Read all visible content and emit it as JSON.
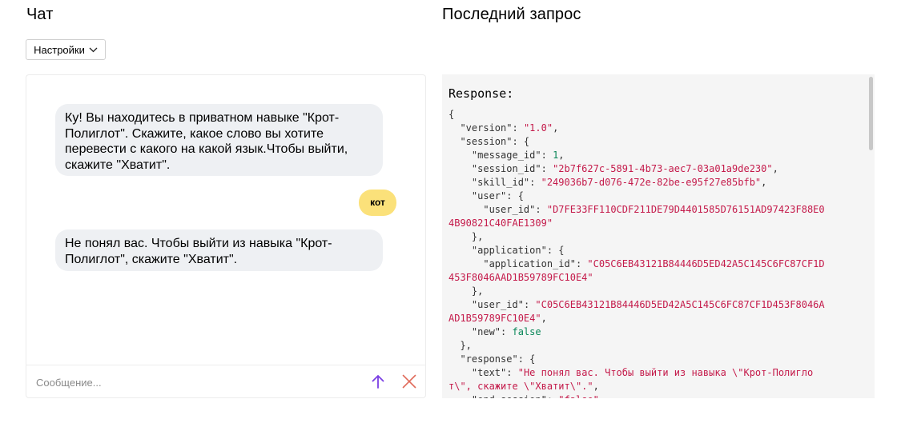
{
  "chat": {
    "title": "Чат",
    "settings_label": "Настройки",
    "messages": [
      {
        "role": "bot",
        "text": "Ку! Вы находитесь в приватном навыке \"Крот-Полиглот\". Скажите, какое слово вы хотите перевести с какого на какой язык.Чтобы выйти, скажите \"Хватит\"."
      },
      {
        "role": "user",
        "text": "кот"
      },
      {
        "role": "bot",
        "text": "Не понял вас. Чтобы выйти из навыка \"Крот-Полиглот\", скажите \"Хватит\"."
      }
    ],
    "input_placeholder": "Сообщение...",
    "input_value": ""
  },
  "request": {
    "title": "Последний запрос",
    "response_label": "Response:",
    "json_lines": [
      {
        "indent": 0,
        "raw": "{"
      },
      {
        "indent": 1,
        "key": "version",
        "value": "\"1.0\"",
        "type": "s",
        "trail": ","
      },
      {
        "indent": 1,
        "key": "session",
        "raw_after": ": {"
      },
      {
        "indent": 2,
        "key": "message_id",
        "value": "1",
        "type": "n",
        "trail": ","
      },
      {
        "indent": 2,
        "key": "session_id",
        "value": "\"2b7f627c-5891-4b73-aec7-03a01a9de230\"",
        "type": "s",
        "trail": ","
      },
      {
        "indent": 2,
        "key": "skill_id",
        "value": "\"249036b7-d076-472e-82be-e95f27e85bfb\"",
        "type": "s",
        "trail": ","
      },
      {
        "indent": 2,
        "key": "user",
        "raw_after": ": {"
      },
      {
        "indent": 3,
        "key": "user_id",
        "value": "\"D7FE33FF110CDF211DE79D4401585D76151AD97423F88E0",
        "type": "s",
        "trail": ""
      },
      {
        "indent": 0,
        "value": "4B90821C40FAE1309\"",
        "type": "s",
        "trail": ""
      },
      {
        "indent": 2,
        "raw": "},"
      },
      {
        "indent": 2,
        "key": "application",
        "raw_after": ": {"
      },
      {
        "indent": 3,
        "key": "application_id",
        "value": "\"C05C6EB43121B84446D5ED42A5C145C6FC87CF1D",
        "type": "s",
        "trail": ""
      },
      {
        "indent": 0,
        "value": "453F8046AAD1B59789FC10E4\"",
        "type": "s",
        "trail": ""
      },
      {
        "indent": 2,
        "raw": "},"
      },
      {
        "indent": 2,
        "key": "user_id",
        "value": "\"C05C6EB43121B84446D5ED42A5C145C6FC87CF1D453F8046A",
        "type": "s",
        "trail": ""
      },
      {
        "indent": 0,
        "value": "AD1B59789FC10E4\"",
        "type": "s",
        "trail": ","
      },
      {
        "indent": 2,
        "key": "new",
        "value": "false",
        "type": "b",
        "trail": ""
      },
      {
        "indent": 1,
        "raw": "},"
      },
      {
        "indent": 1,
        "key": "response",
        "raw_after": ": {"
      },
      {
        "indent": 2,
        "key": "text",
        "value": "\"Не понял вас. Чтобы выйти из навыка \\\"Крот-Полигло",
        "type": "s",
        "trail": ""
      },
      {
        "indent": 0,
        "value": "т\\\", скажите \\\"Хватит\\\".\"",
        "type": "s",
        "trail": ","
      },
      {
        "indent": 2,
        "key": "end_session",
        "value": "\"false\"",
        "type": "s",
        "trail": ""
      }
    ]
  },
  "colors": {
    "bot_bubble": "#eef0f3",
    "user_bubble": "#fbe17a",
    "send_arrow": "#7b3fe4",
    "clear_x": "#e06a5a",
    "string_value": "#c41a4a",
    "number_value": "#098658"
  },
  "icons": {
    "settings_chevron": "chevron-down-icon",
    "send": "arrow-up-icon",
    "clear": "close-icon"
  }
}
